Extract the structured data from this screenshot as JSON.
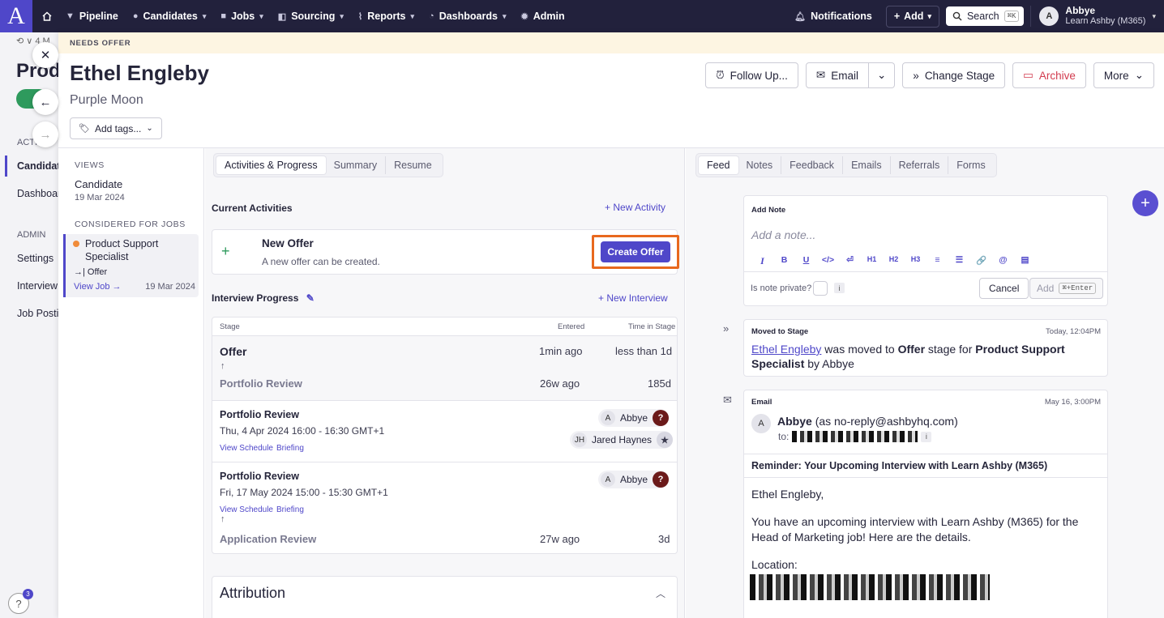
{
  "topnav": {
    "logo": "A",
    "items": [
      {
        "label": "Pipeline"
      },
      {
        "label": "Candidates"
      },
      {
        "label": "Jobs"
      },
      {
        "label": "Sourcing"
      },
      {
        "label": "Reports"
      },
      {
        "label": "Dashboards"
      },
      {
        "label": "Admin"
      }
    ],
    "notifications": "Notifications",
    "add": "Add",
    "search": "Search",
    "search_shortcut": "⌘K",
    "user_initial": "A",
    "user_name": "Abbye",
    "user_org": "Learn Ashby (M365)"
  },
  "background": {
    "title": "Prod",
    "crumb": "⟲ ∨ 4 M",
    "activities_label": "ACTI",
    "nav1": "Candidat",
    "nav2": "Dashboar",
    "admin_label": "ADMIN",
    "admin1": "Settings",
    "admin2": "Interview",
    "admin3": "Job Postin",
    "help_badge": "3"
  },
  "candidate": {
    "status_banner": "NEEDS OFFER",
    "name": "Ethel Engleby",
    "subtitle": "Purple Moon",
    "add_tags": "Add tags..."
  },
  "actions": {
    "follow_up": "Follow Up...",
    "email": "Email",
    "change_stage": "Change Stage",
    "archive": "Archive",
    "more": "More"
  },
  "left_panel": {
    "views_heading": "VIEWS",
    "view_name": "Candidate",
    "view_date": "19 Mar 2024",
    "jobs_heading": "CONSIDERED FOR JOBS",
    "job_title": "Product Support Specialist",
    "job_stage": "Offer",
    "view_job": "View Job",
    "job_date": "19 Mar 2024"
  },
  "middle": {
    "tabs": [
      "Activities & Progress",
      "Summary",
      "Resume"
    ],
    "current_activities": "Current Activities",
    "new_activity": "New Activity",
    "activity_title": "New Offer",
    "activity_desc": "A new offer can be created.",
    "create_offer": "Create Offer",
    "interview_progress": "Interview Progress",
    "new_interview": "New Interview",
    "col_stage": "Stage",
    "col_entered": "Entered",
    "col_time": "Time in Stage",
    "stages": [
      {
        "name": "Offer",
        "entered": "1min ago",
        "time": "less than 1d"
      },
      {
        "name": "Portfolio Review",
        "entered": "26w ago",
        "time": "185d"
      },
      {
        "name": "Application Review",
        "entered": "27w ago",
        "time": "3d"
      }
    ],
    "interviews": [
      {
        "title": "Portfolio Review",
        "time": "Thu, 4 Apr 2024 16:00 - 16:30 GMT+1",
        "p1_initial": "A",
        "p1": "Abbye",
        "p2_initial": "JH",
        "p2": "Jared Haynes"
      },
      {
        "title": "Portfolio Review",
        "time": "Fri, 17 May 2024 15:00 - 15:30 GMT+1",
        "p1_initial": "A",
        "p1": "Abbye"
      }
    ],
    "view_schedule": "View Schedule",
    "briefing": "Briefing",
    "attribution": "Attribution"
  },
  "right": {
    "tabs": [
      "Feed",
      "Notes",
      "Feedback",
      "Emails",
      "Referrals",
      "Forms"
    ],
    "add_note": "Add Note",
    "note_placeholder": "Add a note...",
    "toolbar": [
      "I",
      "B",
      "U",
      "</>",
      "⏎",
      "H1",
      "H2",
      "H3",
      "≡",
      "☰",
      "🔗",
      "@",
      "▤"
    ],
    "is_private": "Is note private?",
    "cancel": "Cancel",
    "add": "Add",
    "add_shortcut": "⌘+Enter",
    "feed1_heading": "Moved to Stage",
    "feed1_time": "Today, 12:04PM",
    "feed1_name": "Ethel Engleby",
    "feed1_t1": " was moved to ",
    "feed1_stage": "Offer",
    "feed1_t2": " stage for ",
    "feed1_job": "Product Support Specialist",
    "feed1_t3": " by Abbye",
    "feed2_heading": "Email",
    "feed2_time": "May 16, 3:00PM",
    "email_initial": "A",
    "email_from_name": "Abbye",
    "email_from_addr": "(as no-reply@ashbyhq.com)",
    "email_to": "to:",
    "email_subject": "Reminder: Your Upcoming Interview with Learn Ashby (M365)",
    "email_greeting": "Ethel Engleby,",
    "email_para": "You have an upcoming interview with Learn Ashby (M365) for the Head of Marketing job! Here are the details.",
    "email_location": "Location:"
  },
  "colors": {
    "accent": "#4f47c9",
    "highlight": "#e8681e",
    "nav_bg": "#22213c"
  }
}
